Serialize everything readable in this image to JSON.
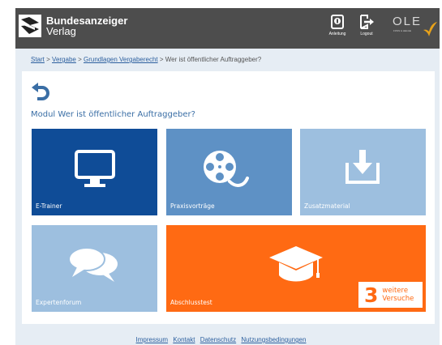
{
  "header": {
    "brand_name": "Bundesanzeiger",
    "brand_sub": "Verlag",
    "anleitung_label": "Anleitung",
    "logout_label": "Logout",
    "ole_text": "OLE",
    "ole_sub": "FOSS & HELGE"
  },
  "breadcrumb": {
    "items": [
      "Start",
      "Vergabe",
      "Grundlagen Vergaberecht"
    ],
    "separator": ">",
    "current": "Wer ist öffentlicher Auftraggeber?"
  },
  "module_title": "Modul Wer ist öffentlicher Auftraggeber?",
  "tiles": {
    "etrainer": {
      "label": "E-Trainer",
      "color": "#0f4c97",
      "icon": "monitor-icon"
    },
    "praxis": {
      "label": "Praxisvorträge",
      "color": "#5e91c5",
      "icon": "film-reel-icon"
    },
    "zusatz": {
      "label": "Zusatzmaterial",
      "color": "#9dbfdf",
      "icon": "download-tray-icon"
    },
    "experten": {
      "label": "Expertenforum",
      "color": "#9dbfdf",
      "icon": "speech-bubbles-icon"
    },
    "abschluss": {
      "label": "Abschlusstest",
      "color": "#ff6a13",
      "icon": "graduation-cap-icon"
    }
  },
  "badge": {
    "number": "3",
    "line1": "weitere",
    "line2": "Versuche"
  },
  "footer": {
    "links": [
      "Impressum",
      "Kontakt",
      "Datenschutz",
      "Nutzungsbedingungen"
    ]
  }
}
